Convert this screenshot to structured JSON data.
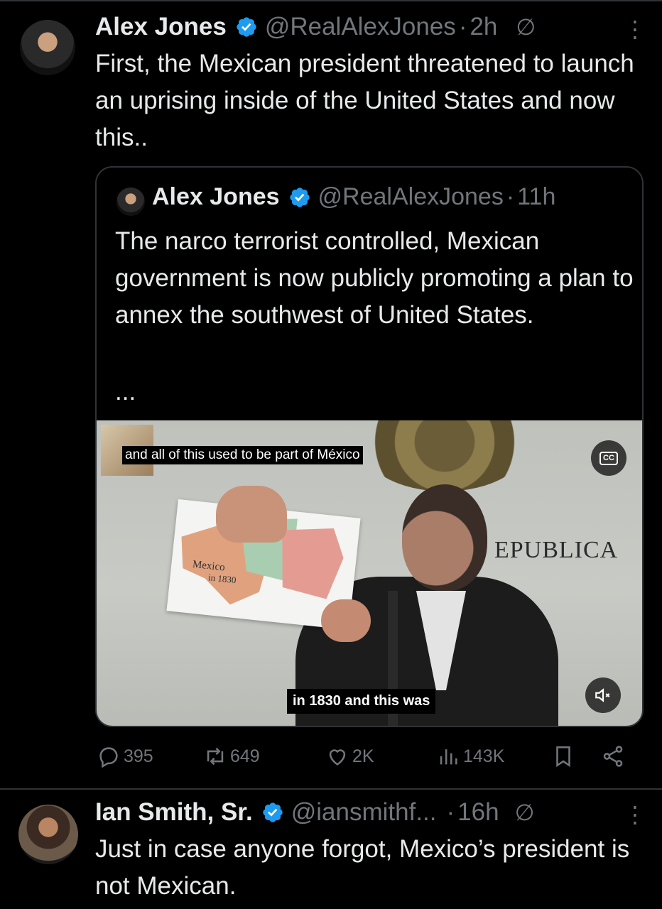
{
  "main_tweet": {
    "display_name": "Alex Jones",
    "handle": "@RealAlexJones",
    "separator": "·",
    "time": "2h",
    "text": "First, the Mexican president threatened to launch an uprising inside of the United States and now this..",
    "quoted_tweet": {
      "display_name": "Alex Jones",
      "handle": "@RealAlexJones",
      "separator": "·",
      "time": "11h",
      "text": "The narco terrorist controlled, Mexican government is now publicly promoting a plan to annex the southwest of United States.",
      "ellipsis": "...",
      "video": {
        "caption_top": "and all of this used to be part of México",
        "caption_bottom": "in 1830 and this was",
        "backdrop_text": "EPUBLICA",
        "map_label": "Mexico",
        "map_sublabel": "in 1830",
        "cc_label": "CC",
        "mute_icon": "speaker-muted-icon"
      }
    },
    "metrics": {
      "replies": "395",
      "reposts": "649",
      "likes": "2K",
      "views": "143K"
    }
  },
  "reply_tweet": {
    "display_name": "Ian Smith, Sr.",
    "handle": "@iansmithf...",
    "separator": "·",
    "time": "16h",
    "text": "Just in case anyone forgot, Mexico’s president is not Mexican."
  },
  "colors": {
    "background": "#000000",
    "text_primary": "#e7e9ea",
    "text_secondary": "#71767b",
    "verified_blue": "#1d9bf0",
    "border": "#2f3336"
  }
}
